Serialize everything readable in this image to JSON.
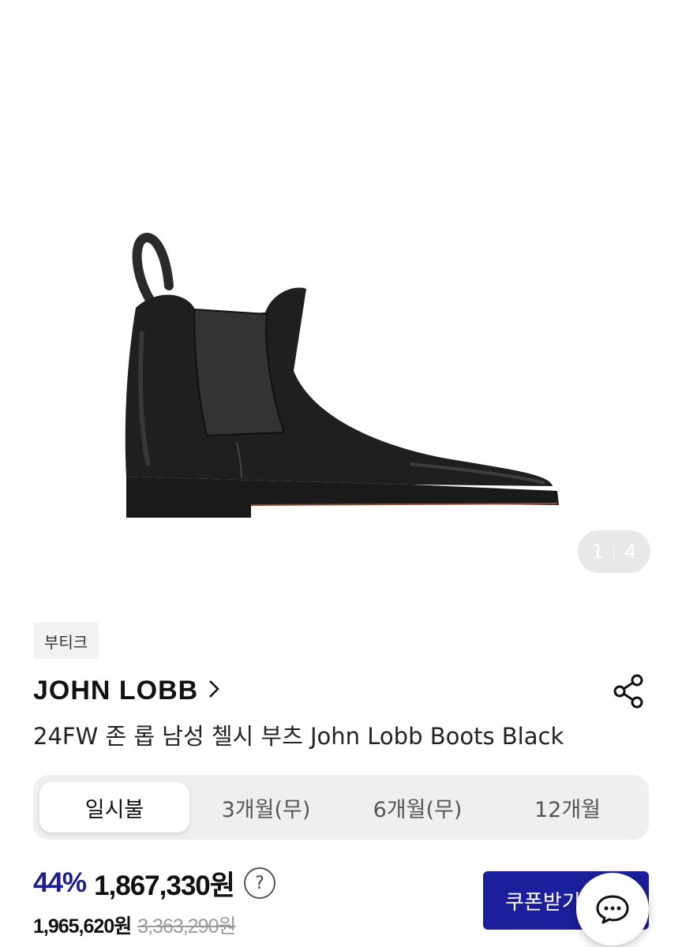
{
  "gallery": {
    "image_alt": "John Lobb black Chelsea boot",
    "counter_current": "1",
    "counter_separator": "|",
    "counter_total": "4"
  },
  "product": {
    "badge": "부티크",
    "brand": "JOHN LOBB",
    "name": "24FW 존 롭 남성 첼시 부츠 John Lobb Boots Black"
  },
  "installment_tabs": [
    {
      "label": "일시불",
      "active": true
    },
    {
      "label": "3개월(무)",
      "active": false
    },
    {
      "label": "6개월(무)",
      "active": false
    },
    {
      "label": "12개월",
      "active": false
    }
  ],
  "pricing": {
    "discount": "44%",
    "sale_price": "1,867,330원",
    "help_symbol": "?",
    "base_price": "1,965,620원",
    "original_price": "3,363,290원"
  },
  "actions": {
    "coupon_label": "쿠폰받기",
    "share_icon": "share-icon",
    "chat_icon": "chat-icon"
  },
  "colors": {
    "accent": "#1b1f9b",
    "discount": "#1d1f8f"
  }
}
